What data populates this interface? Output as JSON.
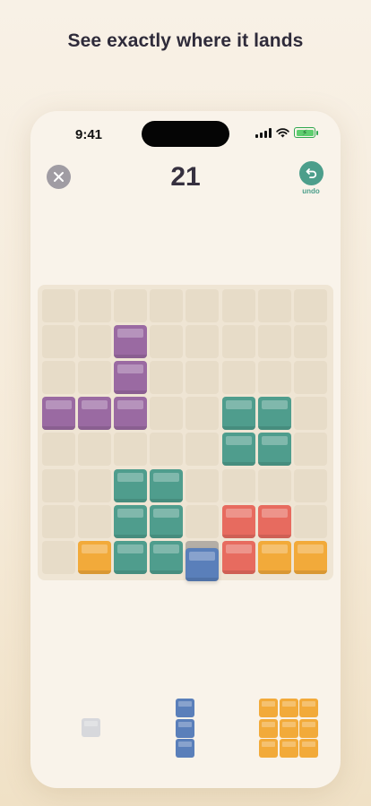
{
  "headline": "See exactly where it lands",
  "status": {
    "time": "9:41",
    "battery_icon": "battery-charging-icon",
    "wifi_icon": "wifi-icon",
    "signal_icon": "cellular-signal-icon"
  },
  "header": {
    "score": "21",
    "close_icon": "close-icon",
    "undo_icon": "undo-arrow-icon",
    "undo_label": "undo"
  },
  "colors": {
    "purple": "#9a6aa2",
    "teal": "#4f9d8d",
    "red": "#e76b5f",
    "orange": "#f2aa3a",
    "blue": "#5a7fba",
    "ghost_gray": "#d7d8dc",
    "shadow": "#b4aea6"
  },
  "board": {
    "rows": 8,
    "cols": 8,
    "blocks": [
      {
        "r": 1,
        "c": 2,
        "color": "purple"
      },
      {
        "r": 2,
        "c": 2,
        "color": "purple"
      },
      {
        "r": 3,
        "c": 0,
        "color": "purple"
      },
      {
        "r": 3,
        "c": 1,
        "color": "purple"
      },
      {
        "r": 3,
        "c": 2,
        "color": "purple"
      },
      {
        "r": 3,
        "c": 5,
        "color": "teal"
      },
      {
        "r": 3,
        "c": 6,
        "color": "teal"
      },
      {
        "r": 4,
        "c": 5,
        "color": "teal"
      },
      {
        "r": 4,
        "c": 6,
        "color": "teal"
      },
      {
        "r": 5,
        "c": 2,
        "color": "teal"
      },
      {
        "r": 5,
        "c": 3,
        "color": "teal"
      },
      {
        "r": 6,
        "c": 2,
        "color": "teal"
      },
      {
        "r": 6,
        "c": 3,
        "color": "teal"
      },
      {
        "r": 6,
        "c": 5,
        "color": "red"
      },
      {
        "r": 6,
        "c": 6,
        "color": "red"
      },
      {
        "r": 7,
        "c": 1,
        "color": "orange"
      },
      {
        "r": 7,
        "c": 2,
        "color": "teal"
      },
      {
        "r": 7,
        "c": 3,
        "color": "teal"
      },
      {
        "r": 7,
        "c": 5,
        "color": "red"
      },
      {
        "r": 7,
        "c": 6,
        "color": "orange"
      },
      {
        "r": 7,
        "c": 7,
        "color": "orange"
      }
    ],
    "dragging_piece": {
      "r": 7,
      "c": 4,
      "color": "blue",
      "landing_preview": "shadow"
    }
  },
  "tray": [
    {
      "name": "tray-piece-single",
      "color": "ghost_gray",
      "rows": 1,
      "cols": 1
    },
    {
      "name": "tray-piece-vertical-3",
      "color": "blue",
      "rows": 3,
      "cols": 1
    },
    {
      "name": "tray-piece-square-3x3",
      "color": "orange",
      "rows": 3,
      "cols": 3
    }
  ]
}
